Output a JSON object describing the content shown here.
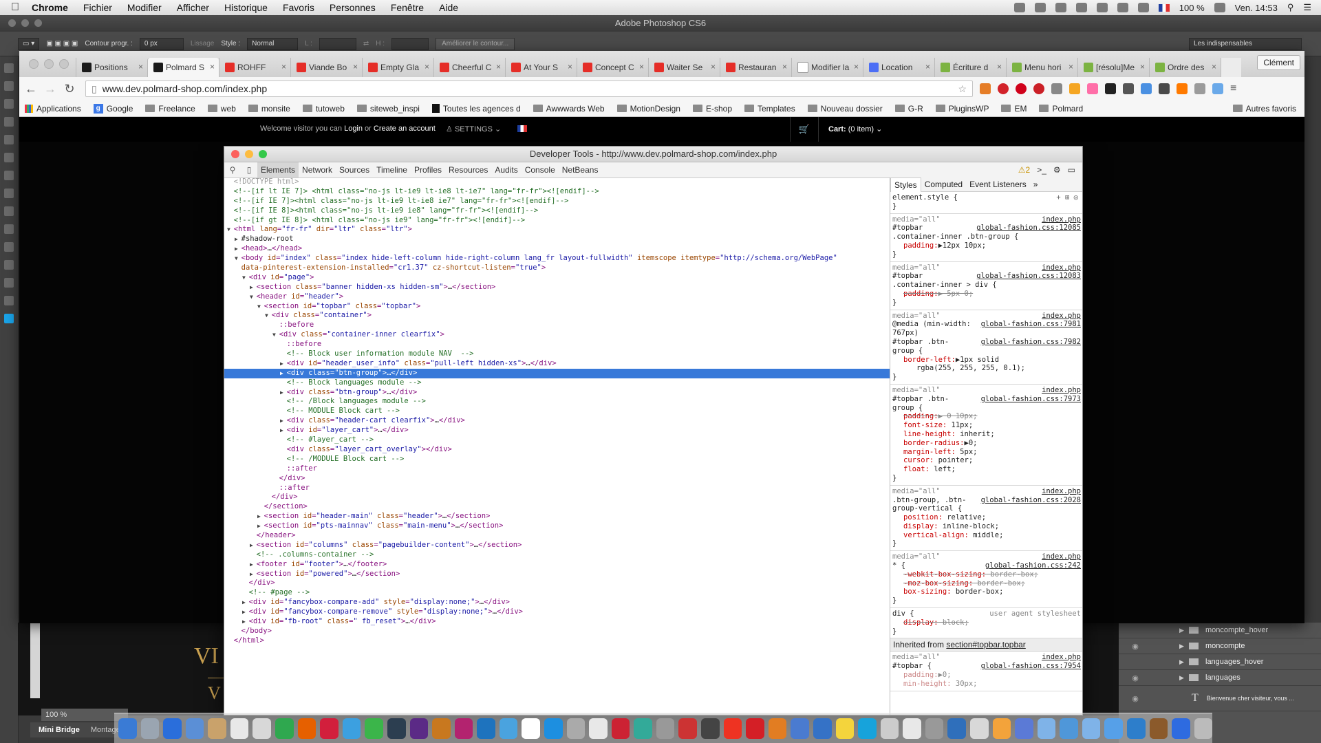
{
  "menubar": {
    "app": "Chrome",
    "items": [
      "Fichier",
      "Modifier",
      "Afficher",
      "Historique",
      "Favoris",
      "Personnes",
      "Fenêtre",
      "Aide"
    ],
    "battery": "100 %",
    "clock": "Ven. 14:53"
  },
  "photoshop": {
    "title": "Adobe Photoshop CS6",
    "contour_label": "Contour progr. :",
    "contour_value": "0 px",
    "lissage": "Lissage",
    "style_label": "Style :",
    "style_value": "Normal",
    "l_label": "L :",
    "h_label": "H :",
    "ameliorer": "Améliorer le contour...",
    "workspace": "Les indispensables",
    "zoom": "100 %",
    "bottom_tabs": [
      "Mini Bridge",
      "Montage"
    ],
    "canvas_text_1": "VI",
    "canvas_text_2": "V",
    "layers": [
      {
        "name": "moncompte_hover",
        "visible": false
      },
      {
        "name": "moncompte",
        "visible": true
      },
      {
        "name": "languages_hover",
        "visible": false
      },
      {
        "name": "languages",
        "visible": true
      }
    ],
    "text_layer": "Bienvenue cher visiteur, vous ..."
  },
  "chrome": {
    "tabs": [
      {
        "label": "Positions",
        "color": "#1a1a1a"
      },
      {
        "label": "Polmard S",
        "color": "#1a1a1a",
        "active": true
      },
      {
        "label": "ROHFF",
        "color": "#e52d27"
      },
      {
        "label": "Viande Bo",
        "color": "#e52d27"
      },
      {
        "label": "Empty Gla",
        "color": "#e52d27"
      },
      {
        "label": "Cheerful C",
        "color": "#e52d27"
      },
      {
        "label": "At Your S",
        "color": "#e52d27"
      },
      {
        "label": "Concept C",
        "color": "#e52d27"
      },
      {
        "label": "Waiter Se",
        "color": "#e52d27"
      },
      {
        "label": "Restauran",
        "color": "#e52d27"
      },
      {
        "label": "Modifier la",
        "color": "#ffffff"
      },
      {
        "label": "Location",
        "color": "#4c6ef5"
      },
      {
        "label": "Écriture d",
        "color": "#7cb342"
      },
      {
        "label": "Menu hori",
        "color": "#7cb342"
      },
      {
        "label": "[résolu]Me",
        "color": "#7cb342"
      },
      {
        "label": "Ordre des",
        "color": "#7cb342"
      }
    ],
    "user": "Clément",
    "url": "www.dev.polmard-shop.com/index.php",
    "bookmarks": [
      "Applications",
      "Google",
      "Freelance",
      "web",
      "monsite",
      "tutoweb",
      "siteweb_inspi",
      "Toutes les agences d",
      "Awwwards Web",
      "MotionDesign",
      "E-shop",
      "Templates",
      "Nouveau dossier",
      "G-R",
      "PluginsWP",
      "EM",
      "Polmard"
    ],
    "other_bookmarks": "Autres favoris"
  },
  "site": {
    "welcome_1": "Welcome visitor you can ",
    "login": "Login",
    "welcome_or": " or ",
    "create": "Create an account",
    "settings": "SETTINGS",
    "cart_label": "Cart:",
    "cart_value": "(0 item)"
  },
  "devtools": {
    "title": "Developer Tools - http://www.dev.polmard-shop.com/index.php",
    "panels": [
      "Elements",
      "Network",
      "Sources",
      "Timeline",
      "Profiles",
      "Resources",
      "Audits",
      "Console",
      "NetBeans"
    ],
    "warnings": "2",
    "style_tabs": [
      "Styles",
      "Computed",
      "Event Listeners"
    ],
    "dom_lines": [
      {
        "i": 0,
        "h": "<span class='d'>&lt;!DOCTYPE html&gt;</span>"
      },
      {
        "i": 0,
        "h": "<span class='c'>&lt;!--[if lt IE 7]&gt; &lt;html class=\"no-js lt-ie9 lt-ie8 lt-ie7\" lang=\"fr-fr\"&gt;&lt;![endif]--&gt;</span>"
      },
      {
        "i": 0,
        "h": "<span class='c'>&lt;!--[if IE 7]&gt;&lt;html class=\"no-js lt-ie9 lt-ie8 ie7\" lang=\"fr-fr\"&gt;&lt;![endif]--&gt;</span>"
      },
      {
        "i": 0,
        "h": "<span class='c'>&lt;!--[if IE 8]&gt;&lt;html class=\"no-js lt-ie9 ie8\" lang=\"fr-fr\"&gt;&lt;![endif]--&gt;</span>"
      },
      {
        "i": 0,
        "h": "<span class='c'>&lt;!--[if gt IE 8]&gt; &lt;html class=\"no-js ie9\" lang=\"fr-fr\"&gt;&lt;![endif]--&gt;</span>"
      },
      {
        "i": 0,
        "tri": "▼",
        "h": "<span class='t'>&lt;html </span><span class='a'>lang</span>=<span class='v'>\"fr-fr\"</span> <span class='a'>dir</span>=<span class='v'>\"ltr\"</span> <span class='a'>class</span>=<span class='v'>\"ltr\"</span><span class='t'>&gt;</span>"
      },
      {
        "i": 1,
        "tri": "▶",
        "h": "<span class='tx'>#shadow-root</span>"
      },
      {
        "i": 1,
        "tri": "▶",
        "h": "<span class='t'>&lt;head&gt;</span><span class='tx'>…</span><span class='t'>&lt;/head&gt;</span>"
      },
      {
        "i": 1,
        "tri": "▼",
        "h": "<span class='t'>&lt;body </span><span class='a'>id</span>=<span class='v'>\"index\"</span> <span class='a'>class</span>=<span class='v'>\"index hide-left-column hide-right-column lang_fr layout-fullwidth\"</span> <span class='a'>itemscope</span> <span class='a'>itemtype</span>=<span class='v'>\"http://schema.org/WebPage\"</span>"
      },
      {
        "i": 1,
        "h": "<span class='a'>data-pinterest-extension-installed</span>=<span class='v'>\"cr1.37\"</span> <span class='a'>cz-shortcut-listen</span>=<span class='v'>\"true\"</span><span class='t'>&gt;</span>"
      },
      {
        "i": 2,
        "tri": "▼",
        "h": "<span class='t'>&lt;div </span><span class='a'>id</span>=<span class='v'>\"page\"</span><span class='t'>&gt;</span>"
      },
      {
        "i": 3,
        "tri": "▶",
        "h": "<span class='t'>&lt;section </span><span class='a'>class</span>=<span class='v'>\"banner hidden-xs hidden-sm\"</span><span class='t'>&gt;</span><span class='tx'>…</span><span class='t'>&lt;/section&gt;</span>"
      },
      {
        "i": 3,
        "tri": "▼",
        "h": "<span class='t'>&lt;header </span><span class='a'>id</span>=<span class='v'>\"header\"</span><span class='t'>&gt;</span>"
      },
      {
        "i": 4,
        "tri": "▼",
        "h": "<span class='t'>&lt;section </span><span class='a'>id</span>=<span class='v'>\"topbar\"</span> <span class='a'>class</span>=<span class='v'>\"topbar\"</span><span class='t'>&gt;</span>"
      },
      {
        "i": 5,
        "tri": "▼",
        "h": "<span class='t'>&lt;div </span><span class='a'>class</span>=<span class='v'>\"container\"</span><span class='t'>&gt;</span>"
      },
      {
        "i": 6,
        "h": "<span class='t'>::before</span>"
      },
      {
        "i": 6,
        "tri": "▼",
        "h": "<span class='t'>&lt;div </span><span class='a'>class</span>=<span class='v'>\"container-inner clearfix\"</span><span class='t'>&gt;</span>"
      },
      {
        "i": 7,
        "h": "<span class='t'>::before</span>"
      },
      {
        "i": 7,
        "h": "<span class='c'>&lt;!-- Block user information module NAV  --&gt;</span>"
      },
      {
        "i": 7,
        "tri": "▶",
        "h": "<span class='t'>&lt;div </span><span class='a'>id</span>=<span class='v'>\"header_user_info\"</span> <span class='a'>class</span>=<span class='v'>\"pull-left hidden-xs\"</span><span class='t'>&gt;</span><span class='tx'>…</span><span class='t'>&lt;/div&gt;</span>"
      },
      {
        "i": 7,
        "tri": "▶",
        "sel": true,
        "h": "<span class='t'>&lt;div </span><span class='a'>class</span>=<span class='v'>\"btn-group\"</span><span class='t'>&gt;</span><span class='tx'>…</span><span class='t'>&lt;/div&gt;</span>"
      },
      {
        "i": 7,
        "h": "<span class='c'>&lt;!-- Block languages module --&gt;</span>"
      },
      {
        "i": 7,
        "tri": "▶",
        "h": "<span class='t'>&lt;div </span><span class='a'>class</span>=<span class='v'>\"btn-group\"</span><span class='t'>&gt;</span><span class='tx'>…</span><span class='t'>&lt;/div&gt;</span>"
      },
      {
        "i": 7,
        "h": "<span class='c'>&lt;!-- /Block languages module --&gt;</span>"
      },
      {
        "i": 7,
        "h": "<span class='c'>&lt;!-- MODULE Block cart --&gt;</span>"
      },
      {
        "i": 7,
        "tri": "▶",
        "h": "<span class='t'>&lt;div </span><span class='a'>class</span>=<span class='v'>\"header-cart clearfix\"</span><span class='t'>&gt;</span><span class='tx'>…</span><span class='t'>&lt;/div&gt;</span>"
      },
      {
        "i": 7,
        "tri": "▶",
        "h": "<span class='t'>&lt;div </span><span class='a'>id</span>=<span class='v'>\"layer_cart\"</span><span class='t'>&gt;</span><span class='tx'>…</span><span class='t'>&lt;/div&gt;</span>"
      },
      {
        "i": 7,
        "h": "<span class='c'>&lt;!-- #layer_cart --&gt;</span>"
      },
      {
        "i": 7,
        "h": "<span class='t'>&lt;div </span><span class='a'>class</span>=<span class='v'>\"layer_cart_overlay\"</span><span class='t'>&gt;&lt;/div&gt;</span>"
      },
      {
        "i": 7,
        "h": "<span class='c'>&lt;!-- /MODULE Block cart --&gt;</span>"
      },
      {
        "i": 7,
        "h": "<span class='t'>::after</span>"
      },
      {
        "i": 6,
        "h": "<span class='t'>&lt;/div&gt;</span>"
      },
      {
        "i": 6,
        "h": "<span class='t'>::after</span>"
      },
      {
        "i": 5,
        "h": "<span class='t'>&lt;/div&gt;</span>"
      },
      {
        "i": 4,
        "h": "<span class='t'>&lt;/section&gt;</span>"
      },
      {
        "i": 4,
        "tri": "▶",
        "h": "<span class='t'>&lt;section </span><span class='a'>id</span>=<span class='v'>\"header-main\"</span> <span class='a'>class</span>=<span class='v'>\"header\"</span><span class='t'>&gt;</span><span class='tx'>…</span><span class='t'>&lt;/section&gt;</span>"
      },
      {
        "i": 4,
        "tri": "▶",
        "h": "<span class='t'>&lt;section </span><span class='a'>id</span>=<span class='v'>\"pts-mainnav\"</span> <span class='a'>class</span>=<span class='v'>\"main-menu\"</span><span class='t'>&gt;</span><span class='tx'>…</span><span class='t'>&lt;/section&gt;</span>"
      },
      {
        "i": 3,
        "h": "<span class='t'>&lt;/header&gt;</span>"
      },
      {
        "i": 3,
        "tri": "▶",
        "h": "<span class='t'>&lt;section </span><span class='a'>id</span>=<span class='v'>\"columns\"</span> <span class='a'>class</span>=<span class='v'>\"pagebuilder-content\"</span><span class='t'>&gt;</span><span class='tx'>…</span><span class='t'>&lt;/section&gt;</span>"
      },
      {
        "i": 3,
        "h": "<span class='c'>&lt;!-- .columns-container --&gt;</span>"
      },
      {
        "i": 3,
        "tri": "▶",
        "h": "<span class='t'>&lt;footer </span><span class='a'>id</span>=<span class='v'>\"footer\"</span><span class='t'>&gt;</span><span class='tx'>…</span><span class='t'>&lt;/footer&gt;</span>"
      },
      {
        "i": 3,
        "tri": "▶",
        "h": "<span class='t'>&lt;section </span><span class='a'>id</span>=<span class='v'>\"powered\"</span><span class='t'>&gt;</span><span class='tx'>…</span><span class='t'>&lt;/section&gt;</span>"
      },
      {
        "i": 2,
        "h": "<span class='t'>&lt;/div&gt;</span>"
      },
      {
        "i": 2,
        "h": "<span class='c'>&lt;!-- #page --&gt;</span>"
      },
      {
        "i": 2,
        "tri": "▶",
        "h": "<span class='t'>&lt;div </span><span class='a'>id</span>=<span class='v'>\"fancybox-compare-add\"</span> <span class='a'>style</span>=<span class='v'>\"display:none;\"</span><span class='t'>&gt;</span><span class='tx'>…</span><span class='t'>&lt;/div&gt;</span>"
      },
      {
        "i": 2,
        "tri": "▶",
        "h": "<span class='t'>&lt;div </span><span class='a'>id</span>=<span class='v'>\"fancybox-compare-remove\"</span> <span class='a'>style</span>=<span class='v'>\"display:none;\"</span><span class='t'>&gt;</span><span class='tx'>…</span><span class='t'>&lt;/div&gt;</span>"
      },
      {
        "i": 2,
        "tri": "▶",
        "h": "<span class='t'>&lt;div </span><span class='a'>id</span>=<span class='v'>\"fb-root\"</span> <span class='a'>class</span>=<span class='v'>\" fb_reset\"</span><span class='t'>&gt;</span><span class='tx'>…</span><span class='t'>&lt;/div&gt;</span>"
      },
      {
        "i": 1,
        "h": "<span class='t'>&lt;/body&gt;</span>"
      },
      {
        "i": 0,
        "h": "<span class='t'>&lt;/html&gt;</span>"
      }
    ],
    "rules": [
      {
        "media": "",
        "src": "",
        "lines": [
          "element.style {"
        ],
        "props": [],
        "close": "}"
      },
      {
        "media": "media=\"all\"",
        "msrc": "index.php",
        "sel": [
          "#topbar",
          ".container-inner .btn-group {"
        ],
        "src": "global-fashion.css:12085",
        "props": [
          {
            "n": "padding",
            "v": "▶12px 10px;",
            "s": false
          }
        ]
      },
      {
        "media": "media=\"all\"",
        "msrc": "index.php",
        "sel": [
          "#topbar",
          ".container-inner > div {"
        ],
        "src": "global-fashion.css:12083",
        "props": [
          {
            "n": "padding",
            "v": "▶ 5px 0;",
            "s": true
          }
        ]
      },
      {
        "media": "media=\"all\"",
        "msrc": "index.php",
        "sel": [
          "@media (min-width:",
          "767px)",
          "#topbar .btn-",
          "group {"
        ],
        "src": "global-fashion.css:7981",
        "src2": "global-fashion.css:7982",
        "props": [
          {
            "n": "border-left",
            "v": "▶1px solid",
            "s": false
          },
          {
            "n": "",
            "v": "   rgba(255, 255, 255, 0.1);",
            "s": false
          }
        ]
      },
      {
        "media": "media=\"all\"",
        "msrc": "index.php",
        "sel": [
          "#topbar .btn-",
          "group {"
        ],
        "src": "global-fashion.css:7973",
        "props": [
          {
            "n": "padding",
            "v": "▶ 0 10px;",
            "s": true
          },
          {
            "n": "font-size",
            "v": " 11px;",
            "s": false
          },
          {
            "n": "line-height",
            "v": " inherit;",
            "s": false
          },
          {
            "n": "border-radius",
            "v": "▶0;",
            "s": false
          },
          {
            "n": "margin-left",
            "v": " 5px;",
            "s": false
          },
          {
            "n": "cursor",
            "v": " pointer;",
            "s": false
          },
          {
            "n": "float",
            "v": " left;",
            "s": false
          }
        ]
      },
      {
        "media": "media=\"all\"",
        "msrc": "index.php",
        "sel": [
          ".btn-group, .btn-",
          "group-vertical {"
        ],
        "src": "global-fashion.css:2028",
        "props": [
          {
            "n": "position",
            "v": " relative;",
            "s": false
          },
          {
            "n": "display",
            "v": " inline-block;",
            "s": false
          },
          {
            "n": "vertical-align",
            "v": " middle;",
            "s": false
          }
        ]
      },
      {
        "media": "media=\"all\"",
        "msrc": "index.php",
        "sel": [
          "* {"
        ],
        "src": "global-fashion.css:242",
        "props": [
          {
            "n": "-webkit-box-sizing",
            "v": " border-box;",
            "s": true
          },
          {
            "n": "-moz-box-sizing",
            "v": " border-box;",
            "s": true
          },
          {
            "n": "box-sizing",
            "v": " border-box;",
            "s": false
          }
        ]
      },
      {
        "media": "",
        "msrc": "",
        "sel": [
          "div {"
        ],
        "src": "user agent stylesheet",
        "props": [
          {
            "n": "display",
            "v": " block;",
            "s": true
          }
        ]
      }
    ],
    "inherited_label": "Inherited from ",
    "inherited_link": "section#topbar.topbar",
    "last_rule": {
      "media": "media=\"all\"",
      "msrc": "index.php",
      "sel": "#topbar {",
      "src": "global-fashion.css:7954",
      "props": [
        {
          "n": "padding",
          "v": "▶0;"
        },
        {
          "n": "min-height",
          "v": " 30px;"
        }
      ]
    }
  },
  "dock_colors": [
    "#3a7bd5",
    "#9aa5b1",
    "#2a6edb",
    "#5b8fd6",
    "#c9a26b",
    "#e8e8e8",
    "#d8d8d8",
    "#2fa84f",
    "#e66000",
    "#d21f3c",
    "#3ca0e0",
    "#3bb54a",
    "#2c3e50",
    "#5b2a86",
    "#c8781f",
    "#b3236f",
    "#1e73be",
    "#4aa3df",
    "#ffffff",
    "#1d8fe0",
    "#aaaaaa",
    "#e8e8e8",
    "#c23",
    "#3a9",
    "#999",
    "#cc3333",
    "#444",
    "#ee3322",
    "#d41f26",
    "#e27d22",
    "#4a7bd0",
    "#3572c6",
    "#f4d43c",
    "#17a3db",
    "#ccc",
    "#e8e8e8",
    "#999",
    "#2f6fbb",
    "#d8d8d8",
    "#f3a33b",
    "#5b7ad6",
    "#7fb3e8",
    "#4f97d9",
    "#7fb3e8",
    "#56a0e8",
    "#2d7ecb",
    "#8b5a2b",
    "#2e6be0",
    "#bbb"
  ]
}
